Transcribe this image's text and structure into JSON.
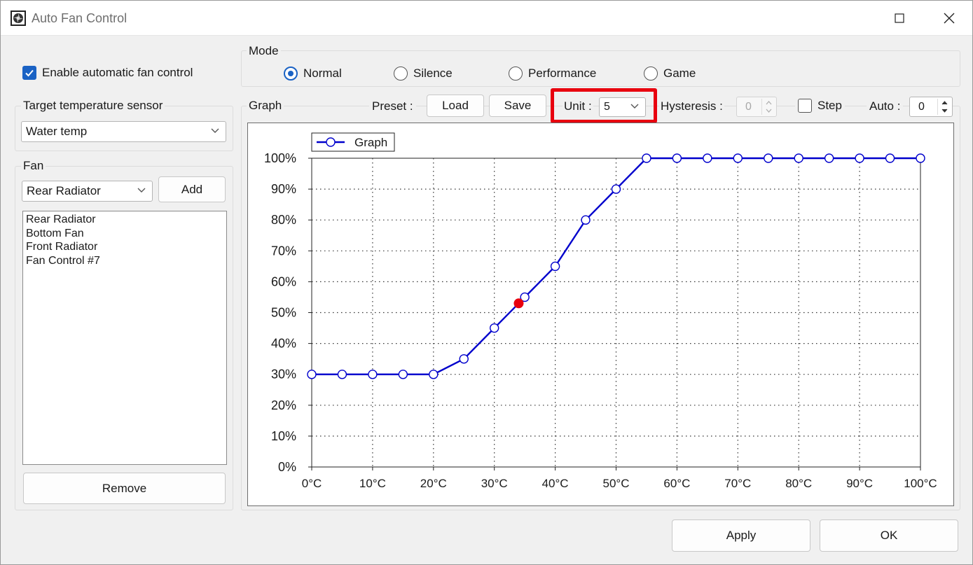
{
  "window": {
    "title": "Auto Fan Control"
  },
  "enable": {
    "label": "Enable automatic fan control",
    "checked": true
  },
  "mode": {
    "label": "Mode",
    "options": [
      "Normal",
      "Silence",
      "Performance",
      "Game"
    ],
    "selected": "Normal"
  },
  "sensor": {
    "label": "Target temperature sensor",
    "value": "Water temp"
  },
  "fan": {
    "label": "Fan",
    "selected": "Rear Radiator",
    "add_label": "Add",
    "list": [
      "Rear Radiator",
      "Bottom Fan",
      "Front Radiator",
      "Fan Control #7"
    ],
    "list_selected": "Front Radiator",
    "remove_label": "Remove"
  },
  "graph_panel": {
    "label": "Graph",
    "preset_label": "Preset :",
    "load_label": "Load",
    "save_label": "Save",
    "unit_label": "Unit :",
    "unit_value": "5",
    "hysteresis_label": "Hysteresis :",
    "hysteresis_value": "0",
    "step_label": "Step",
    "step_checked": false,
    "auto_label": "Auto :",
    "auto_value": "0"
  },
  "footer": {
    "apply_label": "Apply",
    "ok_label": "OK"
  },
  "colors": {
    "accent": "#1a62c4",
    "series": "#0000cc",
    "current_point": "#e8000e",
    "highlight": "#e8000e"
  },
  "chart_data": {
    "type": "line",
    "legend": [
      "Graph"
    ],
    "series": [
      {
        "name": "Graph",
        "x": [
          0,
          5,
          10,
          15,
          20,
          25,
          30,
          35,
          40,
          45,
          50,
          55,
          60,
          65,
          70,
          75,
          80,
          85,
          90,
          95,
          100
        ],
        "values": [
          30,
          30,
          30,
          30,
          30,
          35,
          45,
          55,
          65,
          80,
          90,
          100,
          100,
          100,
          100,
          100,
          100,
          100,
          100,
          100,
          100
        ]
      }
    ],
    "current_point": {
      "x": 34,
      "y": 53
    },
    "x_ticks": [
      "0°C",
      "10°C",
      "20°C",
      "30°C",
      "40°C",
      "50°C",
      "60°C",
      "70°C",
      "80°C",
      "90°C",
      "100°C"
    ],
    "y_ticks": [
      "0%",
      "10%",
      "20%",
      "30%",
      "40%",
      "50%",
      "60%",
      "70%",
      "80%",
      "90%",
      "100%"
    ],
    "xlim": [
      0,
      100
    ],
    "ylim": [
      0,
      100
    ],
    "grid": true,
    "legend_position": "top-left"
  }
}
